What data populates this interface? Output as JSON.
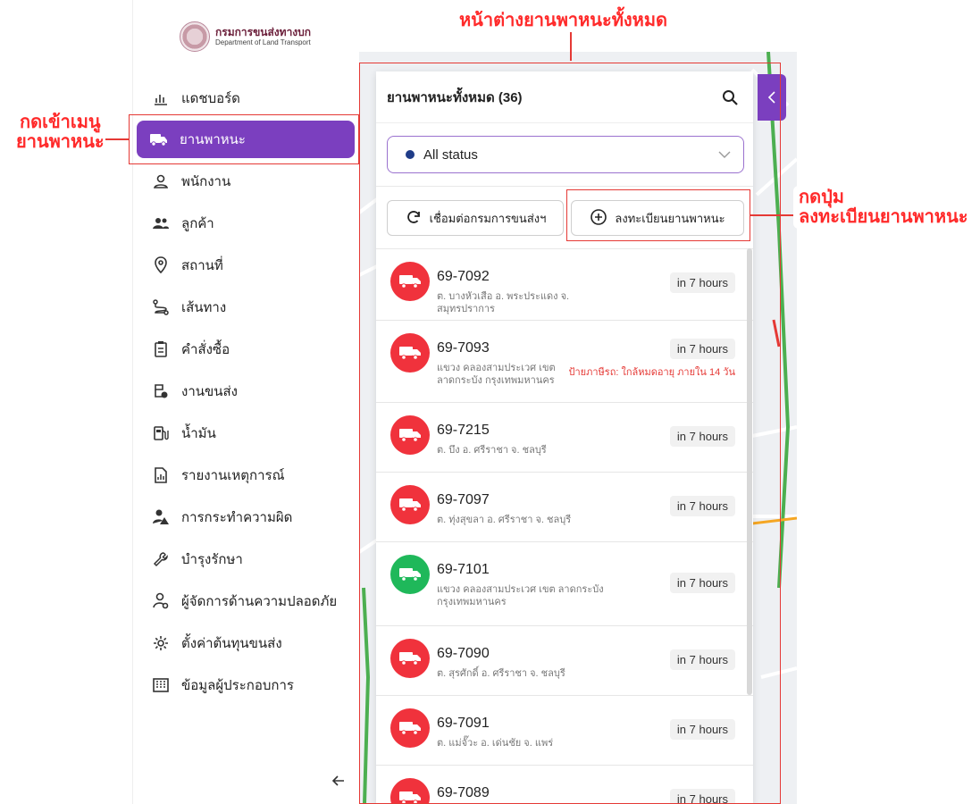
{
  "logo": {
    "thai": "กรมการขนส่งทางบก",
    "english": "Department of Land Transport"
  },
  "sidebar": {
    "items": [
      {
        "label": "แดชบอร์ด",
        "icon": "dashboard-icon",
        "active": false
      },
      {
        "label": "ยานพาหนะ",
        "icon": "truck-icon",
        "active": true
      },
      {
        "label": "พนักงาน",
        "icon": "user-icon",
        "active": false
      },
      {
        "label": "ลูกค้า",
        "icon": "users-icon",
        "active": false
      },
      {
        "label": "สถานที่",
        "icon": "location-pin-icon",
        "active": false
      },
      {
        "label": "เส้นทาง",
        "icon": "route-icon",
        "active": false
      },
      {
        "label": "คำสั่งซื้อ",
        "icon": "clipboard-icon",
        "active": false
      },
      {
        "label": "งานขนส่ง",
        "icon": "delivery-icon",
        "active": false
      },
      {
        "label": "น้ำมัน",
        "icon": "fuel-icon",
        "active": false
      },
      {
        "label": "รายงานเหตุการณ์",
        "icon": "report-icon",
        "active": false
      },
      {
        "label": "การกระทำความผิด",
        "icon": "violation-icon",
        "active": false
      },
      {
        "label": "บำรุงรักษา",
        "icon": "wrench-icon",
        "active": false
      },
      {
        "label": "ผู้จัดการด้านความปลอดภัย",
        "icon": "safety-manager-icon",
        "active": false
      },
      {
        "label": "ตั้งค่าต้นทุนขนส่ง",
        "icon": "gear-icon",
        "active": false
      },
      {
        "label": "ข้อมูลผู้ประกอบการ",
        "icon": "building-icon",
        "active": false
      }
    ]
  },
  "panel": {
    "title": "ยานพาหนะทั้งหมด (36)",
    "status_value": "All status",
    "sync_label": "เชื่อมต่อกรมการขนส่งฯ",
    "register_label": "ลงทะเบียนยานพาหนะ"
  },
  "vehicles": [
    {
      "plate": "69-7092",
      "address": "ต. บางหัวเสือ อ. พระประแดง จ. สมุทรปราการ",
      "time": "in 7 hours",
      "status_color": "#f0323c",
      "warning": ""
    },
    {
      "plate": "69-7093",
      "address": "แขวง คลองสามประเวศ เขต ลาดกระบัง กรุงเทพมหานคร",
      "time": "in 7 hours",
      "status_color": "#f0323c",
      "warning": "ป้ายภาษีรถ: ใกล้หมดอายุ ภายใน 14 วัน"
    },
    {
      "plate": "69-7215",
      "address": "ต. บึง อ. ศรีราชา จ. ชลบุรี",
      "time": "in 7 hours",
      "status_color": "#f0323c",
      "warning": ""
    },
    {
      "plate": "69-7097",
      "address": "ต. ทุ่งสุขลา อ. ศรีราชา จ. ชลบุรี",
      "time": "in 7 hours",
      "status_color": "#f0323c",
      "warning": ""
    },
    {
      "plate": "69-7101",
      "address": "แขวง คลองสามประเวศ เขต ลาดกระบัง กรุงเทพมหานคร",
      "time": "in 7 hours",
      "status_color": "#1fb85a",
      "warning": ""
    },
    {
      "plate": "69-7090",
      "address": "ต. สุรศักดิ์ อ. ศรีราชา จ. ชลบุรี",
      "time": "in 7 hours",
      "status_color": "#f0323c",
      "warning": ""
    },
    {
      "plate": "69-7091",
      "address": "ต. แม่จั๊วะ อ. เด่นชัย จ. แพร่",
      "time": "in 7 hours",
      "status_color": "#f0323c",
      "warning": ""
    },
    {
      "plate": "69-7089",
      "address": "",
      "time": "in 7 hours",
      "status_color": "#f0323c",
      "warning": ""
    }
  ],
  "annotations": {
    "window_label": "หน้าต่างยานพาหนะทั้งหมด",
    "menu_label_line1": "กดเข้าเมนู",
    "menu_label_line2": "ยานพาหนะ",
    "button_label_line1": "กดปุ่ม",
    "button_label_line2": "ลงทะเบียนยานพาหนะ",
    "color": "#ff2a2a"
  },
  "colors": {
    "accent": "#7b3fbf",
    "red_status": "#f0323c",
    "green_status": "#1fb85a"
  }
}
